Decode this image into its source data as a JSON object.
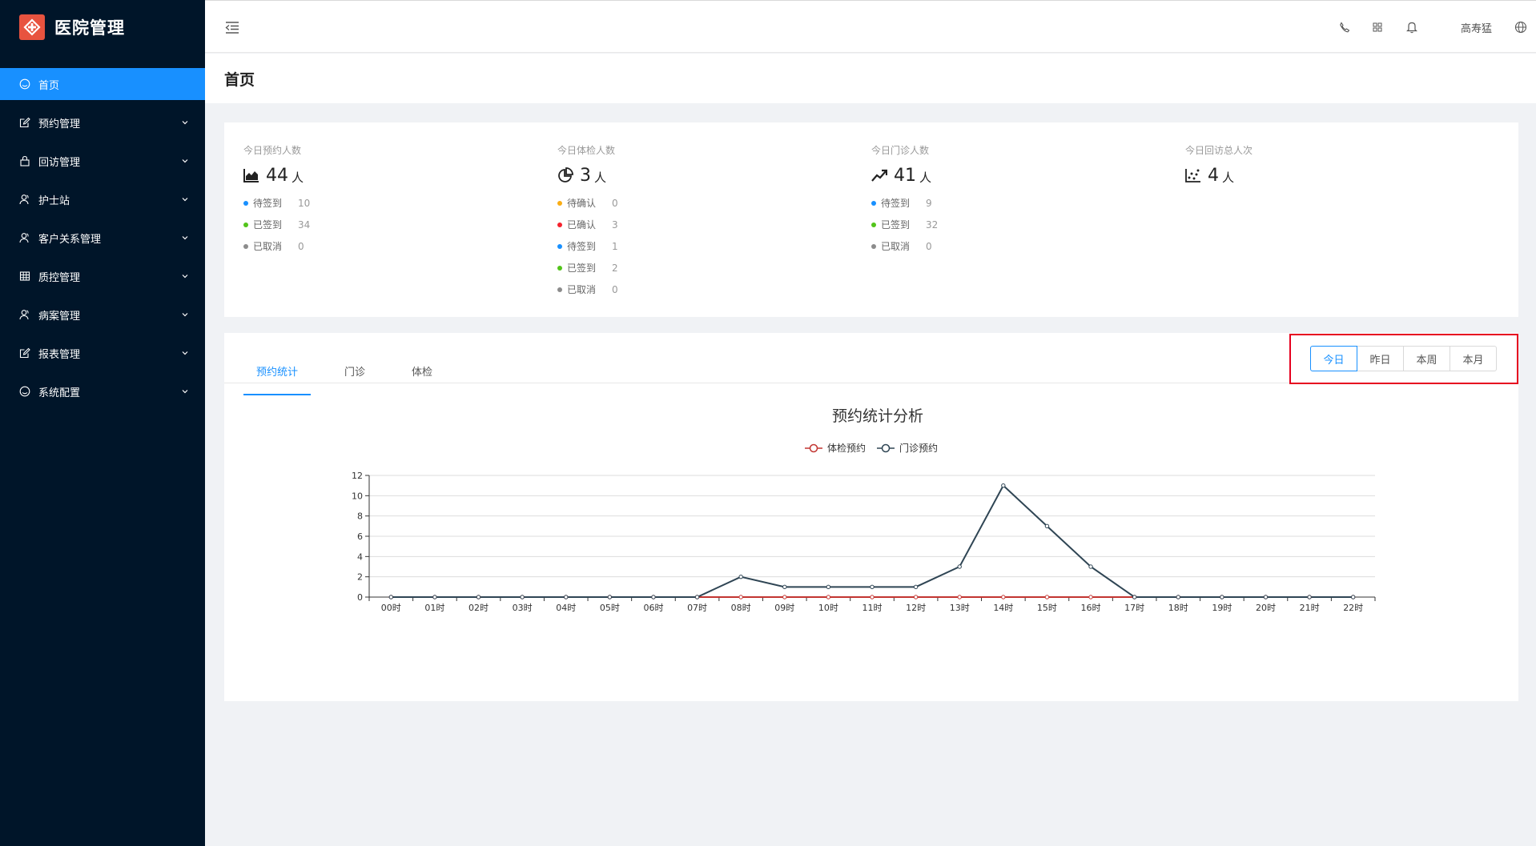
{
  "app": {
    "title": "医院管理"
  },
  "sidebar": {
    "items": [
      {
        "label": "首页",
        "icon": "dashboard-icon",
        "active": true,
        "name": "home"
      },
      {
        "label": "预约管理",
        "icon": "edit-icon",
        "name": "appointment"
      },
      {
        "label": "回访管理",
        "icon": "lock-icon",
        "name": "followup"
      },
      {
        "label": "护士站",
        "icon": "user-icon",
        "name": "nurse"
      },
      {
        "label": "客户关系管理",
        "icon": "user-icon",
        "name": "crm"
      },
      {
        "label": "质控管理",
        "icon": "table-icon",
        "name": "quality"
      },
      {
        "label": "病案管理",
        "icon": "user-icon",
        "name": "records"
      },
      {
        "label": "报表管理",
        "icon": "edit-icon",
        "name": "reports"
      },
      {
        "label": "系统配置",
        "icon": "dashboard-icon",
        "name": "settings"
      }
    ]
  },
  "header": {
    "user": "高寿猛",
    "icons": [
      "phone-icon",
      "apps-icon",
      "bell-icon",
      "globe-icon"
    ]
  },
  "page": {
    "title": "首页"
  },
  "stats": [
    {
      "title": "今日预约人数",
      "icon": "area-chart-icon",
      "value": "44",
      "unit": "人",
      "rows": [
        {
          "label": "待签到",
          "value": "10",
          "color": "#1890ff"
        },
        {
          "label": "已签到",
          "value": "34",
          "color": "#52c41a"
        },
        {
          "label": "已取消",
          "value": "0",
          "color": "#8c8c8c"
        }
      ]
    },
    {
      "title": "今日体检人数",
      "icon": "pie-chart-icon",
      "value": "3",
      "unit": "人",
      "rows": [
        {
          "label": "待确认",
          "value": "0",
          "color": "#faad14"
        },
        {
          "label": "已确认",
          "value": "3",
          "color": "#f5222d"
        },
        {
          "label": "待签到",
          "value": "1",
          "color": "#1890ff"
        },
        {
          "label": "已签到",
          "value": "2",
          "color": "#52c41a"
        },
        {
          "label": "已取消",
          "value": "0",
          "color": "#8c8c8c"
        }
      ]
    },
    {
      "title": "今日门诊人数",
      "icon": "line-chart-icon",
      "value": "41",
      "unit": "人",
      "rows": [
        {
          "label": "待签到",
          "value": "9",
          "color": "#1890ff"
        },
        {
          "label": "已签到",
          "value": "32",
          "color": "#52c41a"
        },
        {
          "label": "已取消",
          "value": "0",
          "color": "#8c8c8c"
        }
      ]
    },
    {
      "title": "今日回访总人次",
      "icon": "dot-chart-icon",
      "value": "4",
      "unit": "人",
      "rows": []
    }
  ],
  "tabs": [
    {
      "label": "预约统计",
      "active": true
    },
    {
      "label": "门诊",
      "active": false
    },
    {
      "label": "体检",
      "active": false
    }
  ],
  "period": {
    "options": [
      "今日",
      "昨日",
      "本周",
      "本月"
    ],
    "selected": "今日"
  },
  "chart_data": {
    "type": "line",
    "title": "预约统计分析",
    "categories": [
      "00时",
      "01时",
      "02时",
      "03时",
      "04时",
      "05时",
      "06时",
      "07时",
      "08时",
      "09时",
      "10时",
      "11时",
      "12时",
      "13时",
      "14时",
      "15时",
      "16时",
      "17时",
      "18时",
      "19时",
      "20时",
      "21时",
      "22时"
    ],
    "series": [
      {
        "name": "体检预约",
        "color": "#c23531",
        "values": [
          0,
          0,
          0,
          0,
          0,
          0,
          0,
          0,
          0,
          0,
          0,
          0,
          0,
          0,
          0,
          0,
          0,
          0,
          0,
          0,
          0,
          0,
          0
        ]
      },
      {
        "name": "门诊预约",
        "color": "#2f4554",
        "values": [
          0,
          0,
          0,
          0,
          0,
          0,
          0,
          0,
          2,
          1,
          1,
          1,
          1,
          3,
          11,
          7,
          3,
          0,
          0,
          0,
          0,
          0,
          0
        ]
      }
    ],
    "ylim": [
      0,
      12
    ],
    "yticks": [
      0,
      2,
      4,
      6,
      8,
      10,
      12
    ],
    "grid": true,
    "legend": "top-center"
  }
}
